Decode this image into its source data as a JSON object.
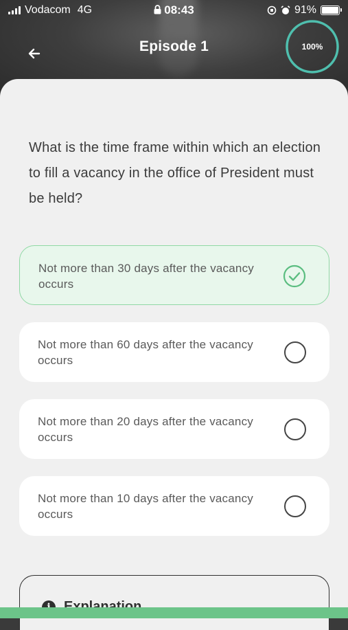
{
  "status_bar": {
    "carrier": "Vodacom",
    "network": "4G",
    "time": "08:43",
    "battery": "91%",
    "battery_level": 0.91
  },
  "header": {
    "title": "Episode 1",
    "progress_label": "100%",
    "progress": 1.0
  },
  "quiz": {
    "question": "What is the time frame within which an election to fill a vacancy in the office of President must be held?",
    "options": [
      {
        "label": "Not more than 30 days after the vacancy occurs",
        "selected": true
      },
      {
        "label": "Not more than 60 days after the vacancy occurs",
        "selected": false
      },
      {
        "label": "Not more than 20 days after the vacancy occurs",
        "selected": false
      },
      {
        "label": "Not more than 10 days after the vacancy occurs",
        "selected": false
      }
    ]
  },
  "explanation": {
    "label": "Explanation"
  },
  "colors": {
    "accent": "#5bbd80",
    "ring": "#4fbfae",
    "selected_bg": "#e8f7ec"
  }
}
